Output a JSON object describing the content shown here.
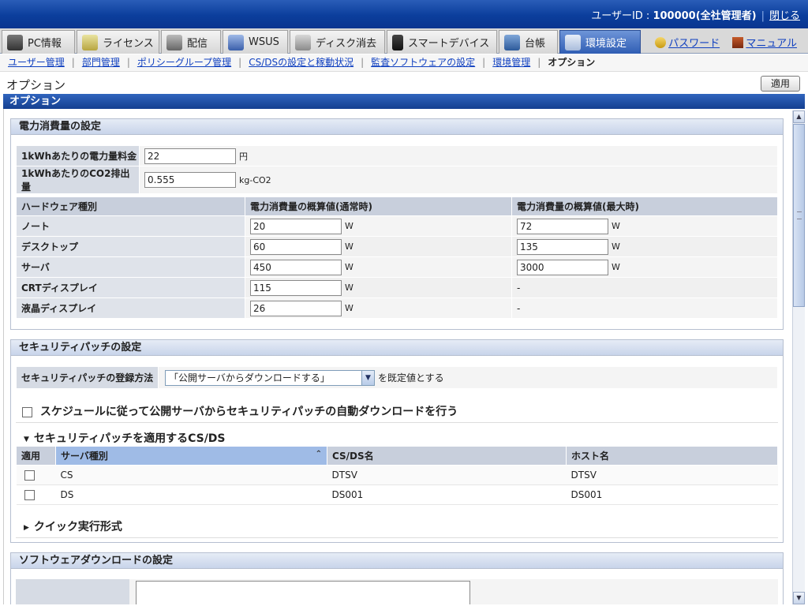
{
  "topbar": {
    "user_label": "ユーザーID : ",
    "user_value": "100000(全社管理者)",
    "close_link": "閉じる"
  },
  "tabs": [
    {
      "label": "PC情報",
      "icon": "pc-icon"
    },
    {
      "label": "ライセンス",
      "icon": "license-icon"
    },
    {
      "label": "配信",
      "icon": "distribution-icon"
    },
    {
      "label": "WSUS",
      "icon": "wsus-icon"
    },
    {
      "label": "ディスク消去",
      "icon": "disk-erase-icon"
    },
    {
      "label": "スマートデバイス",
      "icon": "smart-device-icon"
    },
    {
      "label": "台帳",
      "icon": "ledger-icon"
    },
    {
      "label": "環境設定",
      "icon": "tools-icon"
    }
  ],
  "header_links": {
    "password": "パスワード",
    "manual": "マニュアル"
  },
  "subnav": [
    "ユーザー管理",
    "部門管理",
    "ポリシーグループ管理",
    "CS/DSの設定と稼動状況",
    "監査ソフトウェアの設定",
    "環境管理",
    "オプション"
  ],
  "page": {
    "title": "オプション",
    "apply_button": "適用",
    "section_bar": "オプション"
  },
  "power": {
    "heading": "電力消費量の設定",
    "price_label": "1kWhあたりの電力量料金",
    "price_value": "22",
    "price_unit": "円",
    "co2_label": "1kWhあたりのCO2排出量",
    "co2_value": "0.555",
    "co2_unit": "kg-CO2",
    "columns": [
      "ハードウェア種別",
      "電力消費量の概算値(通常時)",
      "電力消費量の概算値(最大時)"
    ],
    "unit": "W",
    "rows": [
      {
        "type": "ノート",
        "normal": "20",
        "max": "72"
      },
      {
        "type": "デスクトップ",
        "normal": "60",
        "max": "135"
      },
      {
        "type": "サーバ",
        "normal": "450",
        "max": "3000"
      },
      {
        "type": "CRTディスプレイ",
        "normal": "115",
        "max": "-"
      },
      {
        "type": "液晶ディスプレイ",
        "normal": "26",
        "max": "-"
      }
    ]
  },
  "patch": {
    "heading": "セキュリティパッチの設定",
    "method_label": "セキュリティパッチの登録方法",
    "method_value": "「公開サーバからダウンロードする」",
    "method_suffix": "を既定値とする",
    "auto_download_label": "スケジュールに従って公開サーバからセキュリティパッチの自動ダウンロードを行う",
    "auto_download_checked": false,
    "csds_heading": "セキュリティパッチを適用するCS/DS",
    "columns": [
      "適用",
      "サーバ種別",
      "CS/DS名",
      "ホスト名"
    ],
    "rows": [
      {
        "apply": false,
        "server_type": "CS",
        "name": "DTSV",
        "host": "DTSV"
      },
      {
        "apply": false,
        "server_type": "DS",
        "name": "DS001",
        "host": "DS001"
      }
    ],
    "quick_heading": "クイック実行形式"
  },
  "software": {
    "heading": "ソフトウェアダウンロードの設定"
  },
  "colors": {
    "header_blue": "#0b3e9c",
    "active_tab": "#2f5db4",
    "link": "#1040c0",
    "label_bg": "#d6dbe4"
  }
}
